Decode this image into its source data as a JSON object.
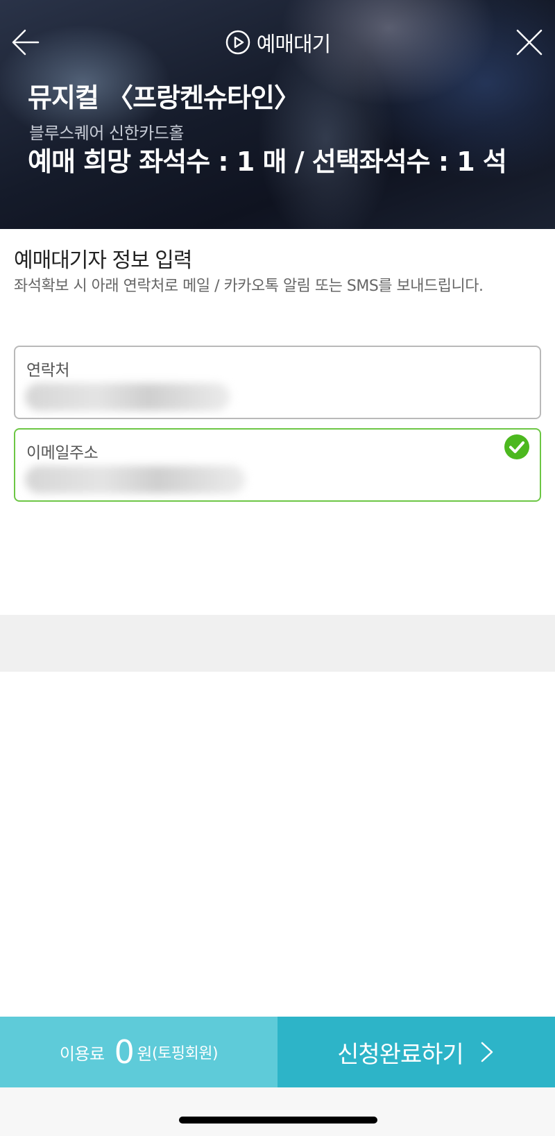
{
  "header": {
    "title": "예매대기",
    "title_icon": "play-circle-icon",
    "back_icon": "arrow-left-icon",
    "close_icon": "close-icon",
    "show_title": "뮤지컬 〈프랑켄슈타인〉",
    "venue": "블루스퀘어 신한카드홀",
    "seat_info": "예매 희망 좌석수 : 1 매 / 선택좌석수 : 1 석"
  },
  "form": {
    "heading": "예매대기자 정보 입력",
    "description": "좌석확보 시 아래 연락처로 메일 / 카카오톡 알림 또는 SMS를 보내드립니다.",
    "contact": {
      "label": "연락처",
      "value_state": "blurred"
    },
    "email": {
      "label": "이메일주소",
      "value_state": "blurred",
      "validated": true
    }
  },
  "footer": {
    "fee_label": "이용료",
    "fee_amount": "0",
    "fee_unit": "원",
    "fee_note": "(토핑회원)",
    "submit_label": "신청완료하기",
    "submit_icon": "chevron-right-icon"
  },
  "colors": {
    "fee_bg": "#5ecbd9",
    "submit_bg": "#2db4c8",
    "valid_green": "#6cc644",
    "check_green": "#4cb81f"
  }
}
